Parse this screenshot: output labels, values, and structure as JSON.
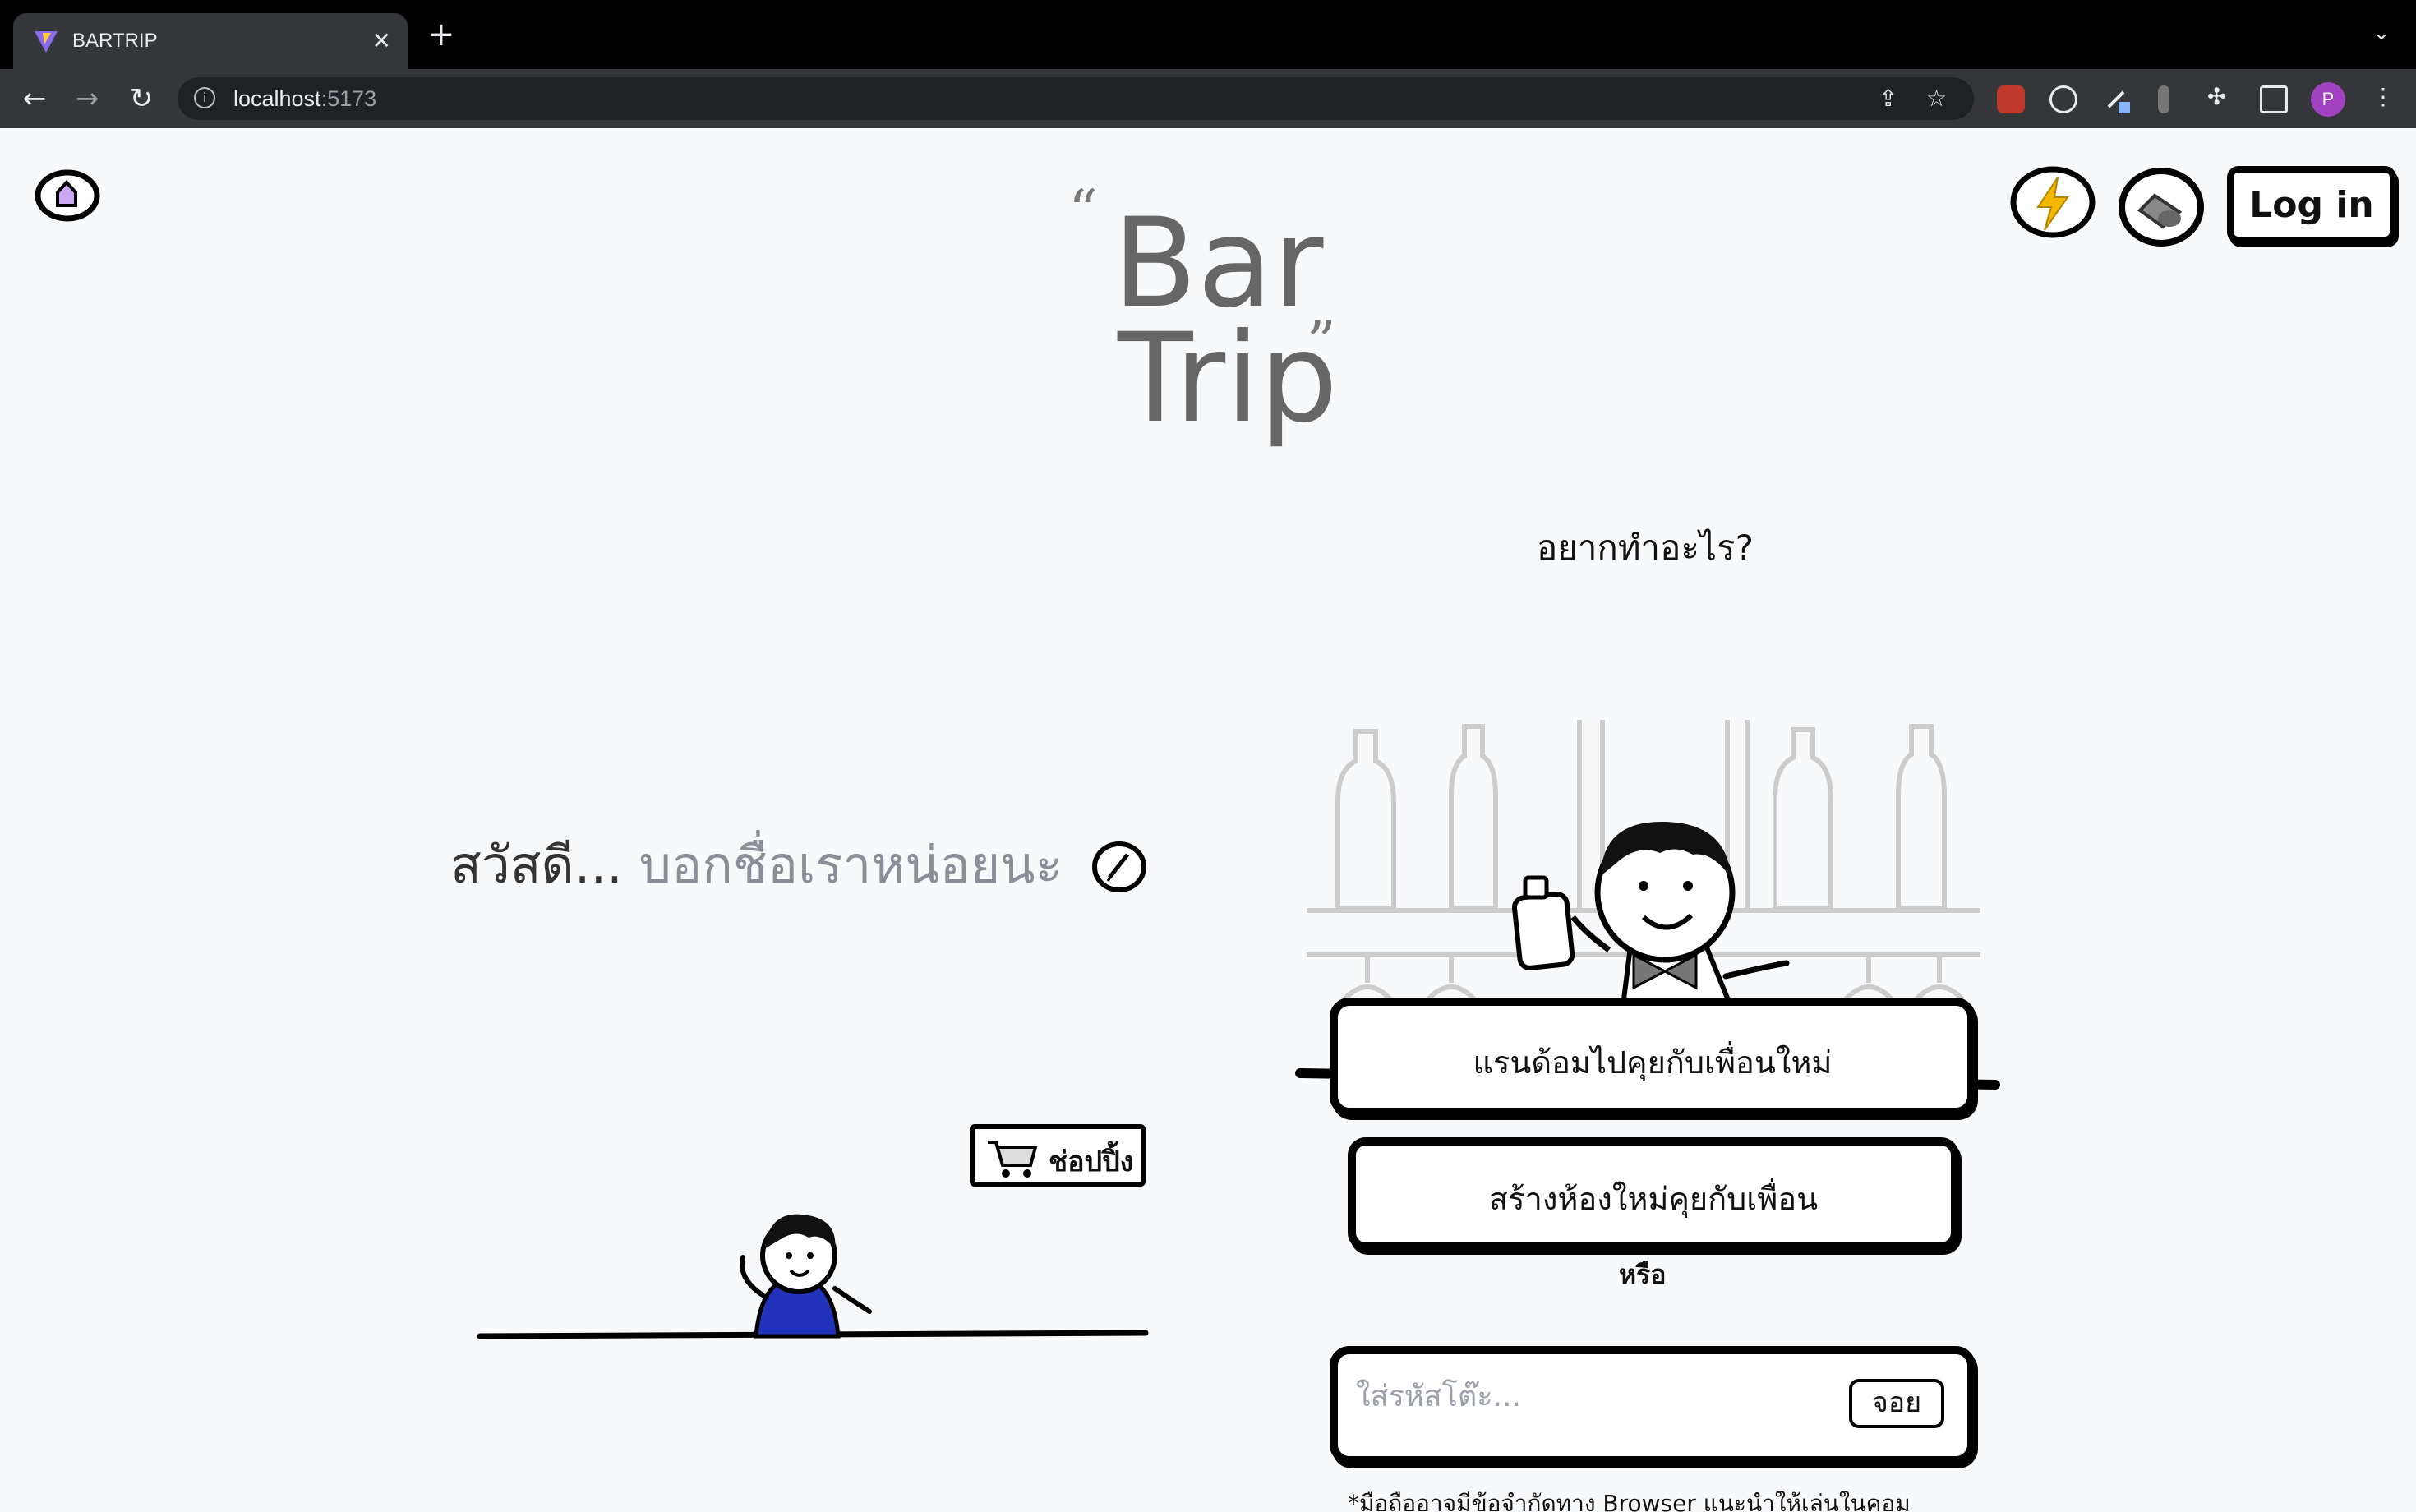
{
  "browser": {
    "tab_title": "BARTRIP",
    "url_host": "localhost",
    "url_port": ":5173",
    "tab_close": "✕",
    "new_tab": "+",
    "profile_initial": "P"
  },
  "header": {
    "login_label": "Log in",
    "logo_line1": "Bar",
    "logo_line2": "Trip",
    "logo_open_quote": "“",
    "logo_close_quote": "”"
  },
  "left": {
    "greeting": "สวัสดี...",
    "name_placeholder": "บอกชื่อเราหน่อยนะ",
    "shop_label": "ช่อปปิ้ง"
  },
  "right": {
    "question": "อยากทำอะไร?",
    "random_button": "แรนด้อมไปคุยกับเพื่อนใหม่",
    "create_room_button": "สร้างห้องใหม่คุยกับเพื่อน",
    "or_label": "หรือ",
    "code_placeholder": "ใส่รหัสโต๊ะ...",
    "join_button": "จอย",
    "notice": "*มือถืออาจมีข้อจำกัดทาง Browser แนะนำให้เล่นในคอม"
  },
  "colors": {
    "accent_yellow": "#f5b800",
    "home_purple": "#c9a7f5",
    "avatar_blue": "#2233bb"
  }
}
